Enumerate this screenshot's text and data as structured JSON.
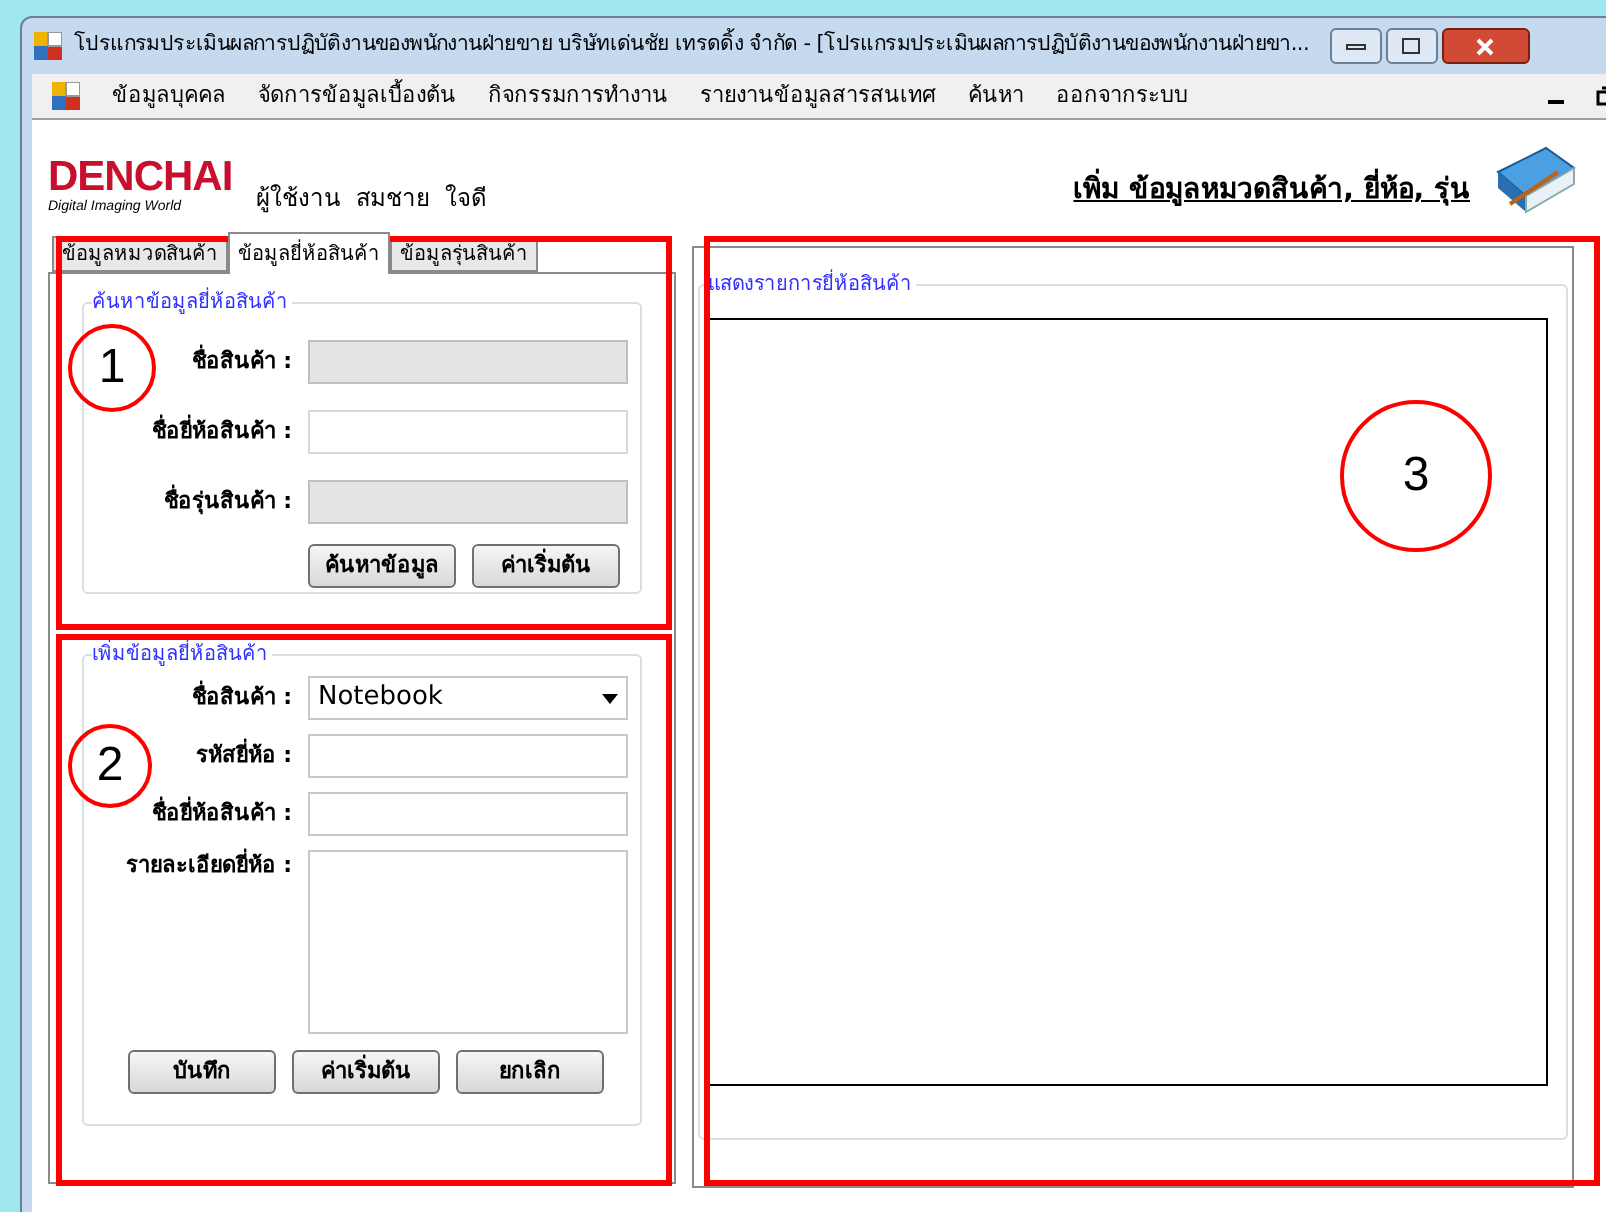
{
  "window": {
    "title": "โปรแกรมประเมินผลการปฏิบัติงานของพนักงานฝ่ายขาย บริษัทเด่นชัย เทรดดิ้ง จำกัด - [โปรแกรมประเมินผลการปฏิบัติงานของพนักงานฝ่ายขา..."
  },
  "menu": [
    "ข้อมูลบุคคล",
    "จัดการข้อมูลเบื้องต้น",
    "กิจกรรมการทำงาน",
    "รายงานข้อมูลสารสนเทศ",
    "ค้นหา",
    "ออกจากระบบ"
  ],
  "logo": {
    "name": "DENCHAI",
    "tagline": "Digital Imaging World"
  },
  "user": "ผู้ใช้งาน  สมชาย  ใจดี",
  "page_title": "เพิ่ม ข้อมูลหมวดสินค้า, ยี่ห้อ, รุ่น",
  "tabs": [
    {
      "label": "ข้อมูลหมวดสินค้า",
      "selected": false
    },
    {
      "label": "ข้อมูลยี่ห้อสินค้า",
      "selected": true
    },
    {
      "label": "ข้อมูลรุ่นสินค้า",
      "selected": false
    }
  ],
  "search_group": {
    "title": "ค้นหาข้อมูลยี่ห้อสินค้า",
    "fields": [
      {
        "label": "ชื่อสินค้า :",
        "disabled": true
      },
      {
        "label": "ชื่อยี่ห้อสินค้า :",
        "disabled": false
      },
      {
        "label": "ชื่อรุ่นสินค้า :",
        "disabled": true
      }
    ],
    "buttons": [
      "ค้นหาข้อมูล",
      "ค่าเริ่มต้น"
    ]
  },
  "add_group": {
    "title": "เพิ่มข้อมูลยี่ห้อสินค้า",
    "fields": [
      {
        "kind": "dropdown",
        "label": "ชื่อสินค้า :",
        "value": "Notebook"
      },
      {
        "kind": "text",
        "label": "รหัสยี่ห้อ :"
      },
      {
        "kind": "text",
        "label": "ชื่อยี่ห้อสินค้า :"
      },
      {
        "kind": "textarea",
        "label": "รายละเอียดยี่ห้อ :"
      }
    ],
    "buttons": [
      "บันทึก",
      "ค่าเริ่มต้น",
      "ยกเลิก"
    ]
  },
  "list_group": {
    "title": "แสดงรายการยี่ห้อสินค้า"
  },
  "annotations": [
    "1",
    "2",
    "3"
  ]
}
